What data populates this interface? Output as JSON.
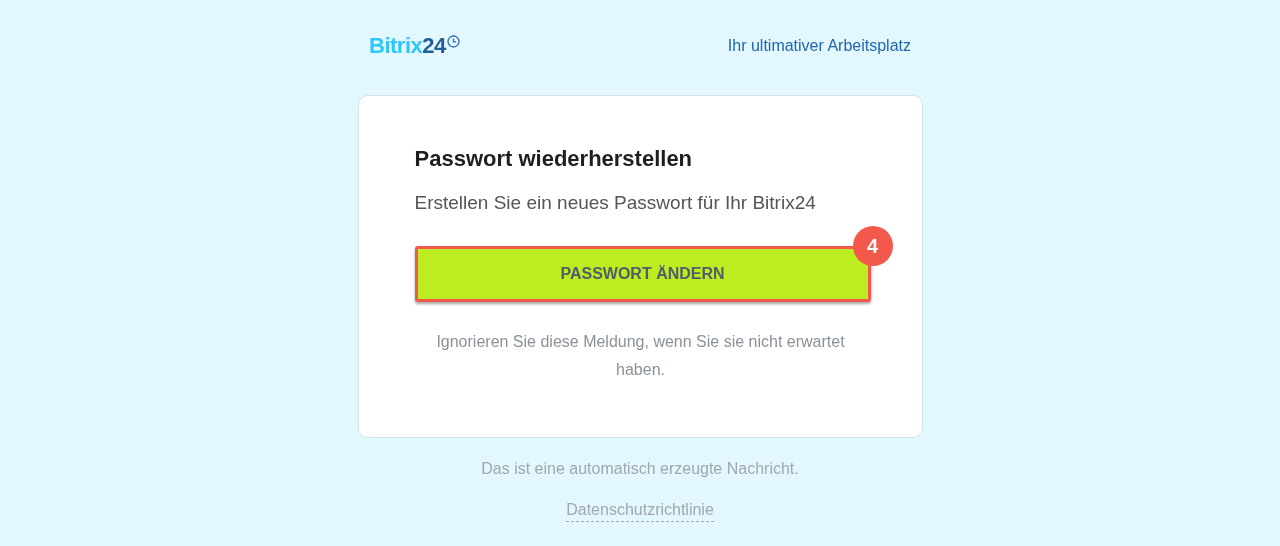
{
  "header": {
    "logo": {
      "name": "Bitrix",
      "number": "24"
    },
    "tagline": "Ihr ultimativer Arbeitsplatz"
  },
  "card": {
    "title": "Passwort wiederherstellen",
    "subtitle": "Erstellen Sie ein neues Passwort für Ihr Bitrix24",
    "button": {
      "label": "PASSWORT ÄNDERN",
      "highlighted": true,
      "badge": "4"
    },
    "note": "Ignorieren Sie diese Meldung, wenn Sie sie nicht erwartet haben."
  },
  "footer": {
    "notice": "Das ist eine automatisch erzeugte Nachricht.",
    "link": "Datenschutzrichtlinie"
  }
}
